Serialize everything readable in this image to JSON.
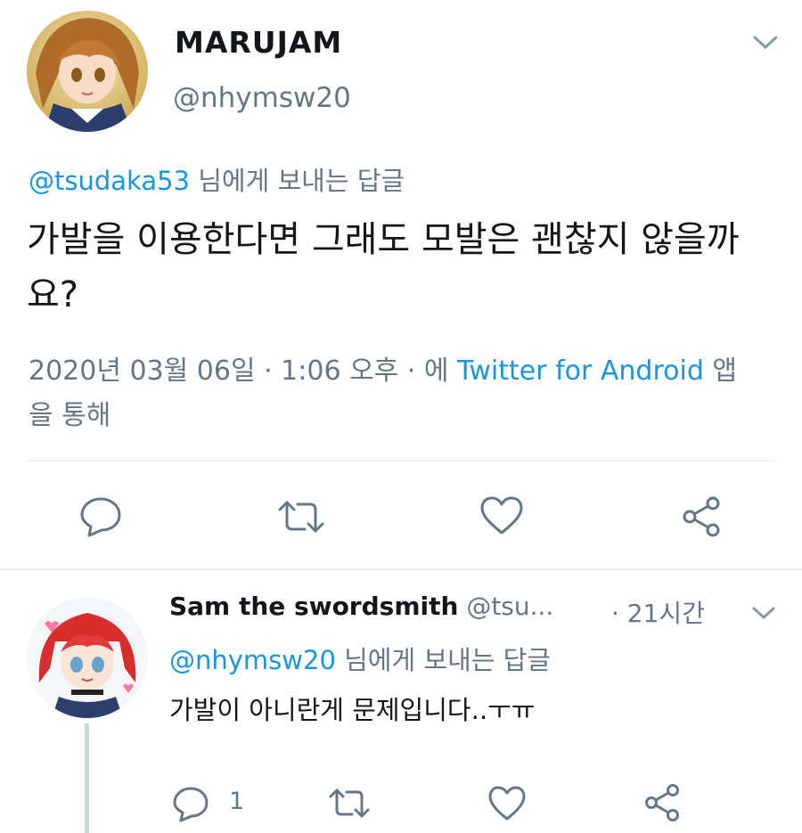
{
  "main_tweet": {
    "display_name": "MARUJAM",
    "handle": "@nhymsw20",
    "reply_to_handle": "@tsudaka53",
    "reply_to_suffix": " 님에게 보내는 답글",
    "text": "가발을 이용한다면 그래도 모발은 괜찮지 않을까요?",
    "meta_date": "2020년 03월 06일 · 1:06 오후 · 에 ",
    "meta_source": "Twitter for Android",
    "meta_suffix": " 앱을 통해",
    "icons": {
      "avatar": "avatar-image",
      "menu": "chevron-down-icon",
      "reply": "reply-icon",
      "retweet": "retweet-icon",
      "like": "heart-icon",
      "share": "share-icon"
    }
  },
  "reply_tweet": {
    "display_name": "Sam the swordsmith",
    "handle": " @tsu...",
    "time": "· 21시간",
    "reply_to_handle": "@nhymsw20",
    "reply_to_suffix": " 님에게 보내는 답글",
    "text": "가발이 아니란게 문제입니다..ㅜㅠ",
    "reply_count": "1",
    "icons": {
      "avatar": "avatar-image",
      "menu": "chevron-down-icon",
      "reply": "reply-icon",
      "retweet": "retweet-icon",
      "like": "heart-icon",
      "share": "share-icon"
    }
  },
  "colors": {
    "link": "#1b95e0",
    "secondary_text": "#657786",
    "primary_text": "#14171a",
    "divider": "#e1e8ed"
  }
}
